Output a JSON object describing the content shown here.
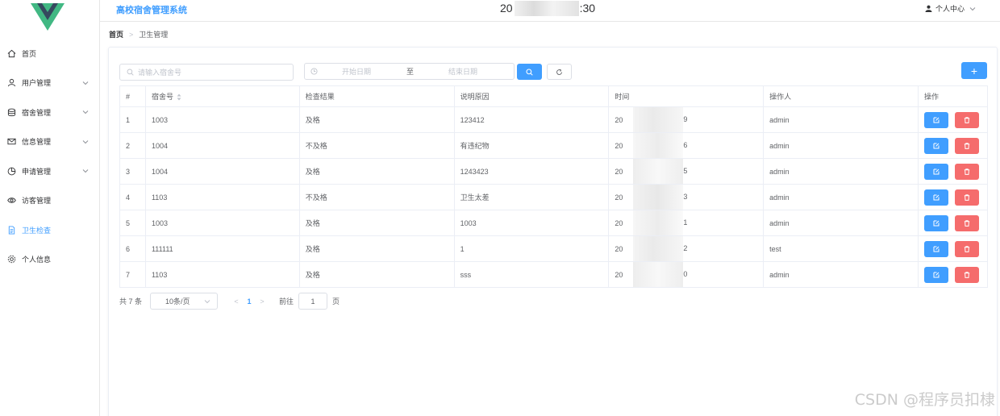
{
  "header": {
    "app_title": "高校宿舍管理系统",
    "clock_prefix": "20",
    "clock_suffix": ":30",
    "user_menu": "个人中心"
  },
  "sidebar": {
    "items": [
      {
        "label": "首页",
        "icon": "home-icon",
        "has_submenu": false,
        "active": false
      },
      {
        "label": "用户管理",
        "icon": "user-icon",
        "has_submenu": true,
        "active": false
      },
      {
        "label": "宿舍管理",
        "icon": "database-icon",
        "has_submenu": true,
        "active": false
      },
      {
        "label": "信息管理",
        "icon": "message-icon",
        "has_submenu": true,
        "active": false
      },
      {
        "label": "申请管理",
        "icon": "pie-chart-icon",
        "has_submenu": true,
        "active": false
      },
      {
        "label": "访客管理",
        "icon": "eye-icon",
        "has_submenu": false,
        "active": false
      },
      {
        "label": "卫生检查",
        "icon": "document-icon",
        "has_submenu": false,
        "active": true
      },
      {
        "label": "个人信息",
        "icon": "gear-icon",
        "has_submenu": false,
        "active": false
      }
    ]
  },
  "breadcrumb": {
    "home": "首页",
    "separator": ">",
    "current": "卫生管理"
  },
  "toolbar": {
    "search_placeholder": "请输入宿舍号",
    "date_start_placeholder": "开始日期",
    "date_separator": "至",
    "date_end_placeholder": "结束日期",
    "add_label": "+"
  },
  "table": {
    "columns": [
      "#",
      "宿舍号",
      "检查结果",
      "说明原因",
      "时间",
      "操作人",
      "操作"
    ],
    "rows": [
      {
        "index": "1",
        "dorm": "1003",
        "result": "及格",
        "reason": "123412",
        "time_prefix": "20",
        "time_suffix": "9",
        "operator": "admin"
      },
      {
        "index": "2",
        "dorm": "1004",
        "result": "不及格",
        "reason": "有违纪物",
        "time_prefix": "20",
        "time_suffix": "6",
        "operator": "admin"
      },
      {
        "index": "3",
        "dorm": "1004",
        "result": "及格",
        "reason": "1243423",
        "time_prefix": "20",
        "time_suffix": "5",
        "operator": "admin"
      },
      {
        "index": "4",
        "dorm": "1103",
        "result": "不及格",
        "reason": "卫生太差",
        "time_prefix": "20",
        "time_suffix": "3",
        "operator": "admin"
      },
      {
        "index": "5",
        "dorm": "1003",
        "result": "及格",
        "reason": "1003",
        "time_prefix": "20",
        "time_suffix": "1",
        "operator": "admin"
      },
      {
        "index": "6",
        "dorm": "111111",
        "result": "及格",
        "reason": "1",
        "time_prefix": "20",
        "time_suffix": "2",
        "operator": "test"
      },
      {
        "index": "7",
        "dorm": "1103",
        "result": "及格",
        "reason": "sss",
        "time_prefix": "20",
        "time_suffix": "0",
        "operator": "admin"
      }
    ]
  },
  "pagination": {
    "total": "共 7 条",
    "page_size": "10条/页",
    "prev": "<",
    "current_page": "1",
    "next": ">",
    "goto_label": "前往",
    "goto_value": "1",
    "page_unit": "页"
  },
  "watermark": "CSDN @程序员扣棣",
  "colors": {
    "primary": "#409eff",
    "danger": "#f56c6c",
    "logo_outer": "#41b883",
    "logo_inner": "#35495e"
  }
}
